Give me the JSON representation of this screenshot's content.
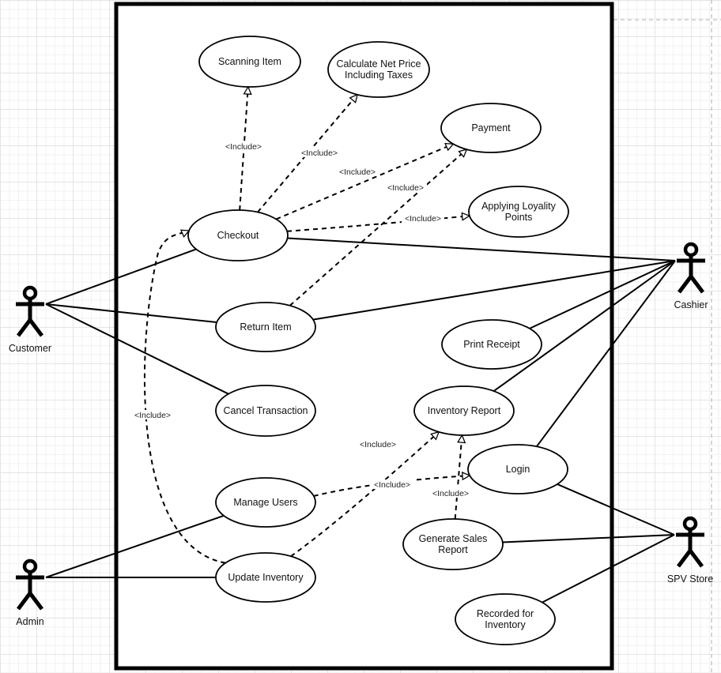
{
  "diagram": {
    "type": "uml-use-case",
    "colors": {
      "line": "#000000",
      "background": "#ffffff",
      "grid": "#e4e4e4"
    },
    "actors": [
      {
        "id": "customer",
        "label": "Customer"
      },
      {
        "id": "cashier",
        "label": "Cashier"
      },
      {
        "id": "admin",
        "label": "Admin"
      },
      {
        "id": "spv",
        "label": "SPV Store"
      }
    ],
    "use_cases": [
      {
        "id": "scanning",
        "lines": [
          "Scanning Item"
        ]
      },
      {
        "id": "calc",
        "lines": [
          "Calculate Net Price",
          "Including Taxes"
        ]
      },
      {
        "id": "payment",
        "lines": [
          "Payment"
        ]
      },
      {
        "id": "loyalty",
        "lines": [
          "Applying Loyality",
          "Points"
        ]
      },
      {
        "id": "checkout",
        "lines": [
          "Checkout"
        ]
      },
      {
        "id": "return",
        "lines": [
          "Return Item"
        ]
      },
      {
        "id": "print",
        "lines": [
          "Print Receipt"
        ]
      },
      {
        "id": "cancel",
        "lines": [
          "Cancel Transaction"
        ]
      },
      {
        "id": "invreport",
        "lines": [
          "Inventory Report"
        ]
      },
      {
        "id": "login",
        "lines": [
          "Login"
        ]
      },
      {
        "id": "manage",
        "lines": [
          "Manage Users"
        ]
      },
      {
        "id": "gensales",
        "lines": [
          "Generate Sales",
          "Report"
        ]
      },
      {
        "id": "update",
        "lines": [
          "Update Inventory"
        ]
      },
      {
        "id": "recorded",
        "lines": [
          "Recorded for",
          "Inventory"
        ]
      }
    ],
    "associations": [
      [
        "customer",
        "checkout"
      ],
      [
        "customer",
        "return"
      ],
      [
        "customer",
        "cancel"
      ],
      [
        "cashier",
        "checkout"
      ],
      [
        "cashier",
        "return"
      ],
      [
        "cashier",
        "print"
      ],
      [
        "cashier",
        "invreport"
      ],
      [
        "cashier",
        "login"
      ],
      [
        "admin",
        "manage"
      ],
      [
        "admin",
        "update"
      ],
      [
        "spv",
        "login"
      ],
      [
        "spv",
        "gensales"
      ],
      [
        "spv",
        "recorded"
      ]
    ],
    "include_label": "<Include>",
    "includes": [
      {
        "from": "checkout",
        "to": "scanning",
        "label": "<Include>"
      },
      {
        "from": "checkout",
        "to": "calc",
        "label": "<Include>"
      },
      {
        "from": "checkout",
        "to": "payment",
        "label": "<Include>"
      },
      {
        "from": "checkout",
        "to": "loyalty",
        "label": "<Include>"
      },
      {
        "from": "return",
        "to": "payment",
        "label": "<Include>"
      },
      {
        "from": "update",
        "to": "checkout",
        "label": "<Include>"
      },
      {
        "from": "update",
        "to": "invreport",
        "label": "<Include>"
      },
      {
        "from": "manage",
        "to": "login",
        "label": "<Include>"
      },
      {
        "from": "gensales",
        "to": "invreport",
        "label": "<Include>"
      }
    ]
  }
}
